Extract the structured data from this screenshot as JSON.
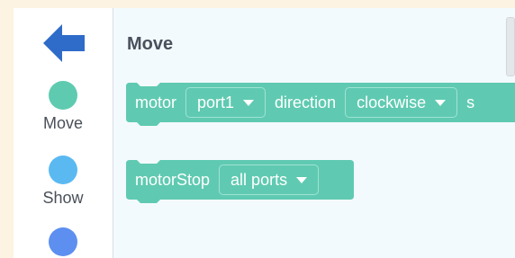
{
  "colors": {
    "block": "#5fcab1",
    "move_dot": "#5ecbb0",
    "show_dot": "#5bb9f2",
    "third_dot": "#5d8ff0",
    "back_arrow": "#2f6cc9"
  },
  "sidebar": {
    "back_icon": "arrow-left-icon",
    "categories": [
      {
        "label": "Move"
      },
      {
        "label": "Show"
      },
      {
        "label": ""
      }
    ]
  },
  "workspace": {
    "title": "Move",
    "blocks": [
      {
        "text1": "motor",
        "dropdown1": "port1",
        "text2": "direction",
        "dropdown2": "clockwise",
        "text3": "s"
      },
      {
        "text1": "motorStop",
        "dropdown1": "all ports"
      }
    ]
  }
}
